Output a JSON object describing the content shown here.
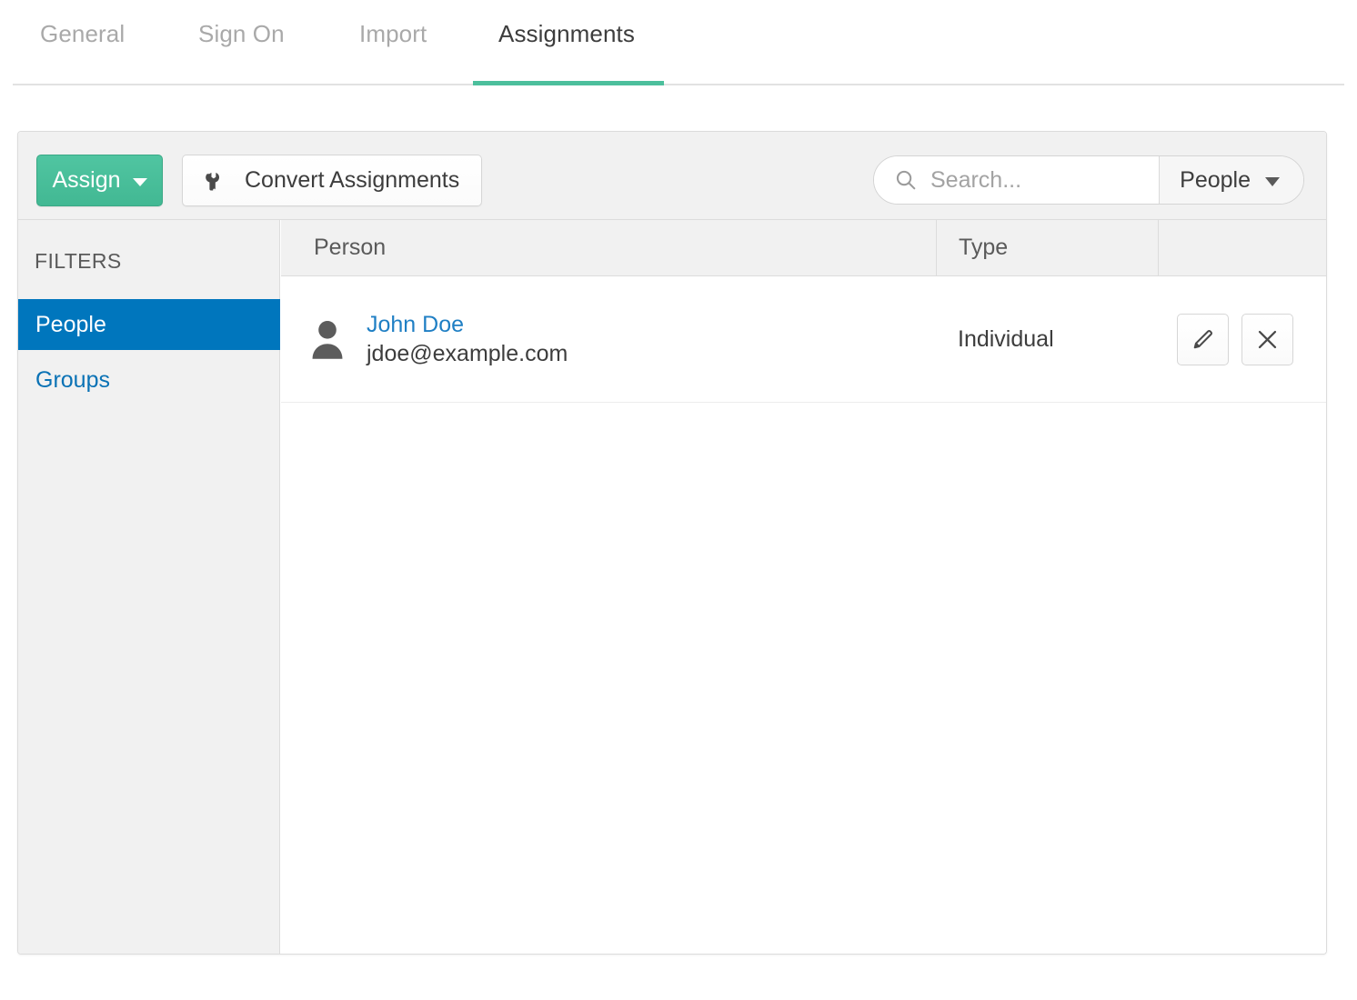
{
  "tabs": [
    {
      "label": "General",
      "active": false
    },
    {
      "label": "Sign On",
      "active": false
    },
    {
      "label": "Import",
      "active": false
    },
    {
      "label": "Assignments",
      "active": true
    }
  ],
  "toolbar": {
    "assign_label": "Assign",
    "assign_caret_icon": "caret-down-icon",
    "convert_label": "Convert Assignments",
    "convert_icon": "wrench-icon",
    "search": {
      "icon": "search-icon",
      "placeholder": "Search...",
      "value": ""
    },
    "scope": {
      "selected": "People",
      "caret_icon": "caret-down-icon"
    }
  },
  "sidebar": {
    "heading": "FILTERS",
    "items": [
      {
        "label": "People",
        "selected": true
      },
      {
        "label": "Groups",
        "selected": false
      }
    ]
  },
  "table": {
    "columns": [
      {
        "label": "Person"
      },
      {
        "label": "Type"
      },
      {
        "label": ""
      }
    ],
    "rows": [
      {
        "avatar_icon": "person-avatar-icon",
        "name": "John Doe",
        "email": "jdoe@example.com",
        "type": "Individual",
        "edit_icon": "pencil-icon",
        "remove_icon": "close-icon"
      }
    ]
  },
  "colors": {
    "accent_green": "#4cbf9c",
    "accent_blue": "#0076bd",
    "link_blue": "#1f7fc4",
    "panel_gray": "#f1f1f1",
    "border_gray": "#dcdcdc"
  }
}
